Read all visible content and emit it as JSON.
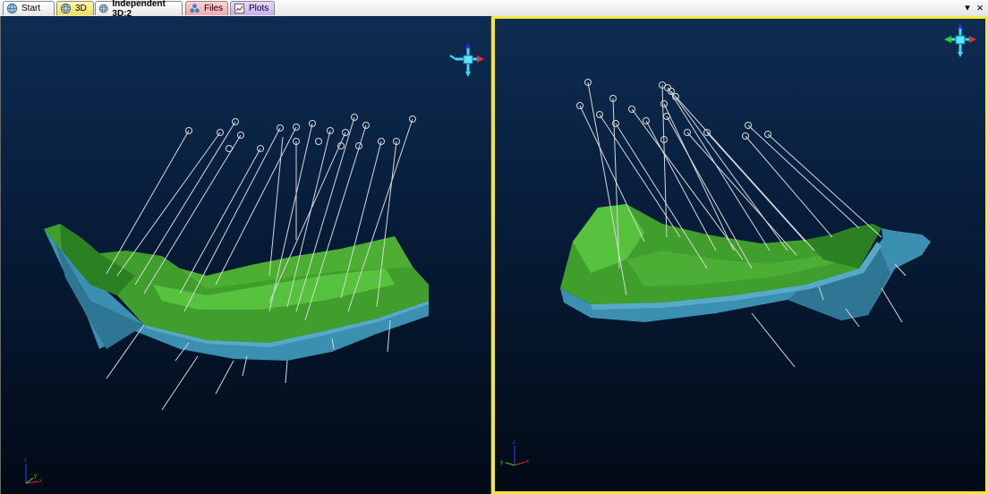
{
  "tabs": [
    {
      "label": "Start",
      "icon": "globe-icon"
    },
    {
      "label": "3D",
      "icon": "3d-globe-icon"
    },
    {
      "label": "Independent 3D:2",
      "icon": "3d-globe-icon"
    },
    {
      "label": "Files",
      "icon": "files-icon"
    },
    {
      "label": "Plots",
      "icon": "plots-icon"
    }
  ],
  "active_tab": "3D",
  "window_controls": {
    "menu_arrow": "▾",
    "close": "×"
  },
  "viewports": [
    {
      "name": "left",
      "active": false
    },
    {
      "name": "right",
      "active": true
    }
  ],
  "colors": {
    "surface_top": "#3f9e2c",
    "surface_side": "#3b8fb0",
    "drillhole": "#d8d8d8",
    "active_border": "#f0e93a",
    "background_top": "#0e2c52",
    "background_bottom": "#020a16"
  }
}
